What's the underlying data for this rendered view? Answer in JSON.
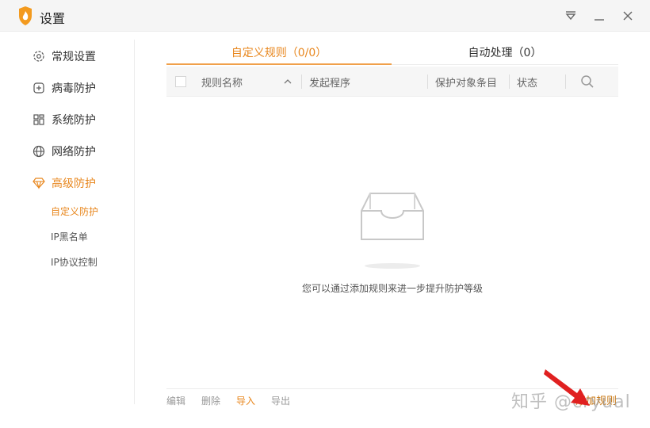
{
  "window": {
    "title": "设置"
  },
  "sidebar": {
    "items": [
      {
        "label": "常规设置",
        "icon": "gear-icon"
      },
      {
        "label": "病毒防护",
        "icon": "plus-square-icon"
      },
      {
        "label": "系统防护",
        "icon": "grid-icon"
      },
      {
        "label": "网络防护",
        "icon": "globe-icon"
      },
      {
        "label": "高级防护",
        "icon": "diamond-icon"
      }
    ],
    "sub_items": [
      {
        "label": "自定义防护"
      },
      {
        "label": "IP黑名单"
      },
      {
        "label": "IP协议控制"
      }
    ],
    "active_item": "高级防护",
    "active_sub_item": "自定义防护"
  },
  "tabs": [
    {
      "label": "自定义规则（0/0）"
    },
    {
      "label": "自动处理（0）"
    }
  ],
  "table": {
    "columns": [
      "规则名称",
      "发起程序",
      "保护对象条目",
      "状态"
    ]
  },
  "empty_state": {
    "message": "您可以通过添加规则来进一步提升防护等级"
  },
  "footer": {
    "buttons": [
      "编辑",
      "删除",
      "导入",
      "导出"
    ],
    "add_rule": "添加规则",
    "watermark": "知乎 @cryual"
  },
  "colors": {
    "accent": "#e8871e",
    "arrow": "#e02020"
  }
}
